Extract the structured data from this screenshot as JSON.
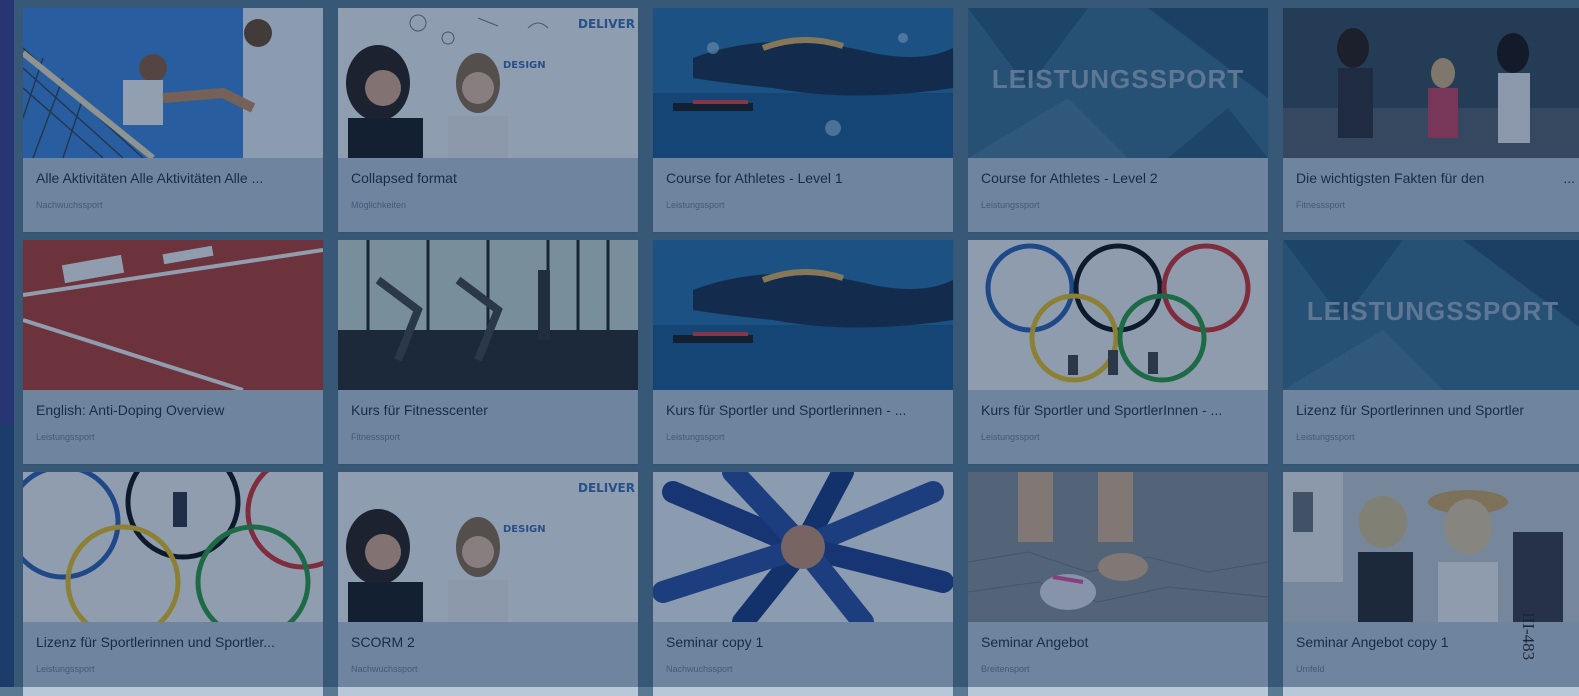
{
  "cards": [
    {
      "title": "Alle Aktivitäten Alle Aktivitäten Alle ...",
      "sub": "Nachwuchssport",
      "thumb": "volleyball"
    },
    {
      "title": "Collapsed format",
      "sub": "Möglichkeiten",
      "thumb": "design"
    },
    {
      "title": "Course for Athletes - Level 1",
      "sub": "Leistungssport",
      "thumb": "swim"
    },
    {
      "title": "Course for Athletes - Level 2",
      "sub": "Leistungssport",
      "thumb": "leistungssport"
    },
    {
      "title": "Die wichtigsten Fakten für den",
      "sub": "Fitnesssport",
      "thumb": "gym-women",
      "more": "..."
    },
    {
      "title": "English: Anti-Doping Overview",
      "sub": "Leistungssport",
      "thumb": "track"
    },
    {
      "title": "Kurs für Fitnesscenter",
      "sub": "Fitnesssport",
      "thumb": "treadmill"
    },
    {
      "title": "Kurs für Sportler und Sportlerinnen - ...",
      "sub": "Leistungssport",
      "thumb": "swim"
    },
    {
      "title": "Kurs für Sportler und SportlerInnen - ...",
      "sub": "Leistungssport",
      "thumb": "olympic"
    },
    {
      "title": "Lizenz für Sportlerinnen und Sportler",
      "sub": "Leistungssport",
      "thumb": "leistungssport"
    },
    {
      "title": "Lizenz für Sportlerinnen und Sportler...",
      "sub": "Leistungssport",
      "thumb": "olympic2"
    },
    {
      "title": "SCORM 2",
      "sub": "Nachwuchssport",
      "thumb": "design"
    },
    {
      "title": "Seminar copy 1",
      "sub": "Nachwuchssport",
      "thumb": "hands"
    },
    {
      "title": "Seminar Angebot",
      "sub": "Breitensport",
      "thumb": "shoe"
    },
    {
      "title": "Seminar Angebot copy 1",
      "sub": "Umfeld",
      "thumb": "women-outdoor"
    }
  ],
  "leistungssport_text": "LEISTUNGSSPORT",
  "deliver_text": "DELIVER !",
  "design_text": "DESIGN",
  "side_label": "III-483"
}
